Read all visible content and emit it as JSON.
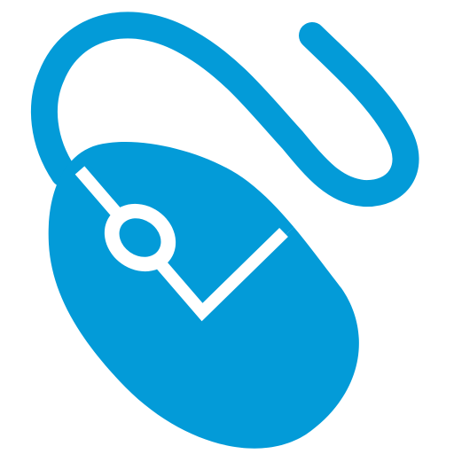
{
  "icon": {
    "name": "computer-mouse-icon",
    "color": "#039bd8",
    "background": "#ffffff"
  }
}
